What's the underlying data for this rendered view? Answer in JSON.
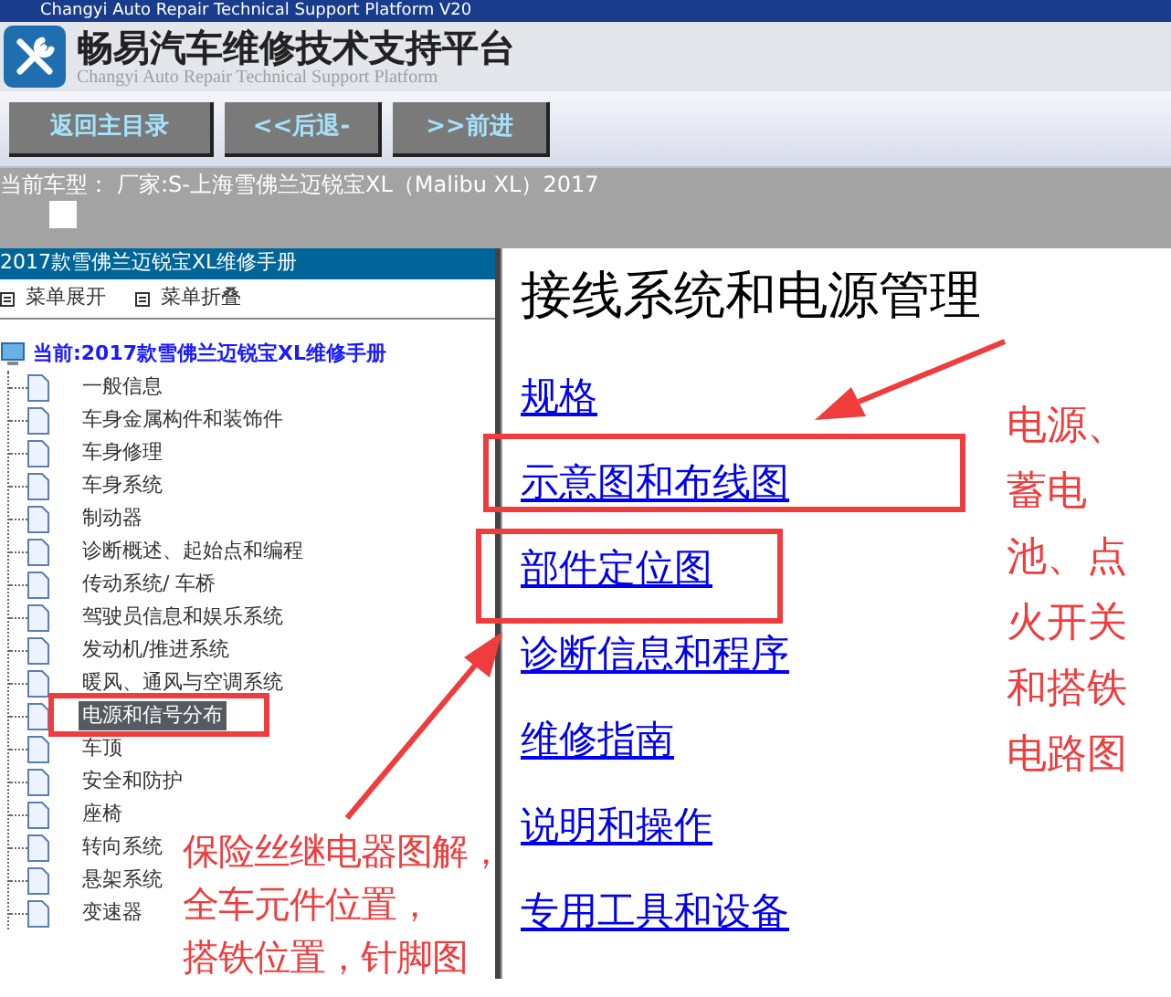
{
  "window": {
    "title": "Changyi Auto Repair Technical Support Platform V20"
  },
  "header": {
    "title": "畅易汽车维修技术支持平台",
    "subtitle": "Changyi Auto Repair Technical Support Platform"
  },
  "nav_buttons": [
    "返回主目录",
    "<<后退-",
    ">>前进"
  ],
  "vehicle_bar": {
    "label": "当前车型：",
    "value": "厂家:S-上海雪佛兰迈锐宝XL（Malibu XL）2017"
  },
  "manual_panel": {
    "title": "2017款雪佛兰迈锐宝XL维修手册",
    "menu_actions": [
      "菜单展开",
      "菜单折叠"
    ],
    "tree": {
      "label": "当前:2017款雪佛兰迈锐宝XL维修手册",
      "children": [
        {
          "label": "一般信息",
          "selected": false
        },
        {
          "label": "车身金属构件和装饰件",
          "selected": false
        },
        {
          "label": "车身修理",
          "selected": false
        },
        {
          "label": "车身系统",
          "selected": false
        },
        {
          "label": "制动器",
          "selected": false
        },
        {
          "label": "诊断概述、起始点和编程",
          "selected": false
        },
        {
          "label": "传动系统/ 车桥",
          "selected": false
        },
        {
          "label": "驾驶员信息和娱乐系统",
          "selected": false
        },
        {
          "label": "发动机/推进系统",
          "selected": false
        },
        {
          "label": "暖风、通风与空调系统",
          "selected": false
        },
        {
          "label": "电源和信号分布",
          "selected": true
        },
        {
          "label": "车顶",
          "selected": false
        },
        {
          "label": "安全和防护",
          "selected": false
        },
        {
          "label": "座椅",
          "selected": false
        },
        {
          "label": "转向系统",
          "selected": false
        },
        {
          "label": "悬架系统",
          "selected": false
        },
        {
          "label": "变速器",
          "selected": false
        }
      ]
    }
  },
  "content": {
    "heading": "接线系统和电源管理",
    "links": [
      "规格",
      "示意图和布线图",
      "部件定位图",
      "诊断信息和程序",
      "维修指南",
      "说明和操作",
      "专用工具和设备"
    ]
  },
  "annotations": {
    "left_note": [
      "保险丝继电器图解，",
      "全车元件位置，",
      "搭铁位置，针脚图"
    ],
    "right_note": "电源、蓄电池、点火开关和搭铁电路图"
  }
}
